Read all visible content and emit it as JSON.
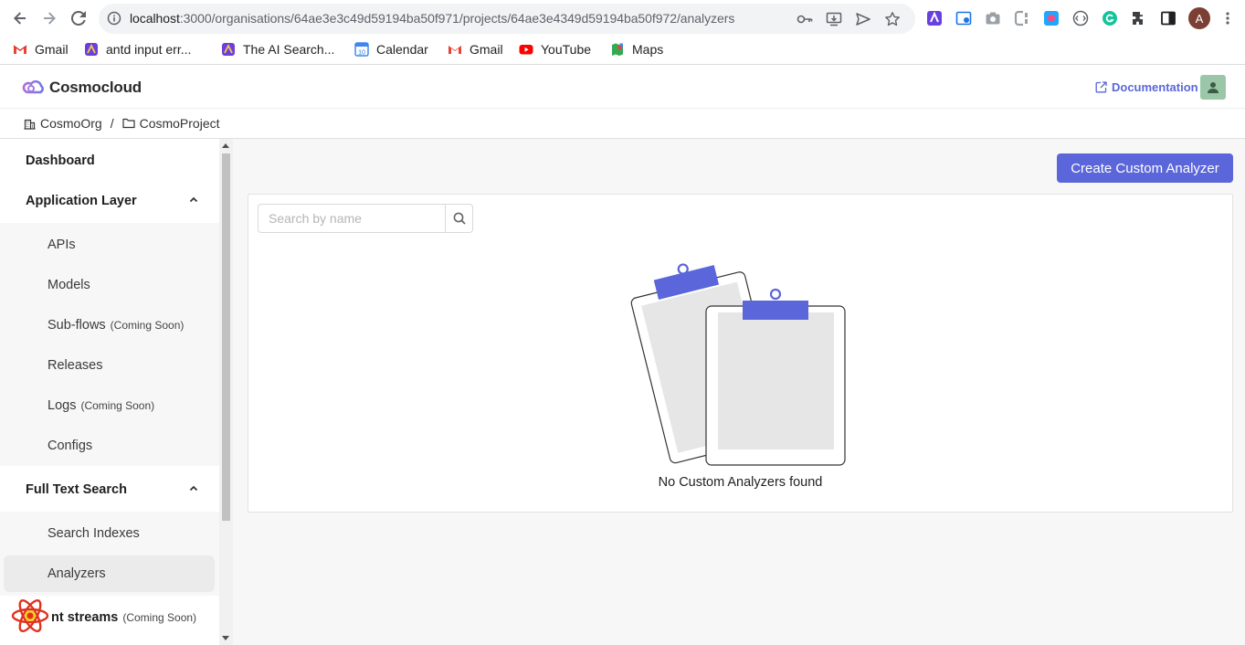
{
  "browser": {
    "url_host": "localhost",
    "url_path": ":3000/organisations/64ae3e3c49d59194ba50f971/projects/64ae3e4349d59194ba50f972/analyzers",
    "profile_initial": "A",
    "bookmarks": [
      {
        "label": "Gmail",
        "icon": "gmail-icon",
        "color": "#ea4335"
      },
      {
        "label": "antd input err...",
        "icon": "ai-search-icon",
        "color": "#7b3fe4"
      },
      {
        "label": "The AI Search...",
        "icon": "ai-search-icon",
        "color": "#7b3fe4"
      },
      {
        "label": "Calendar",
        "icon": "calendar-icon",
        "color": "#4285f4"
      },
      {
        "label": "Gmail",
        "icon": "gmail-icon",
        "color": "#ea4335"
      },
      {
        "label": "YouTube",
        "icon": "youtube-icon",
        "color": "#ff0000"
      },
      {
        "label": "Maps",
        "icon": "maps-icon",
        "color": "#34a853"
      }
    ]
  },
  "header": {
    "brand": "Cosmocloud",
    "doc_link": "Documentation"
  },
  "breadcrumb": {
    "org": "CosmoOrg",
    "separator": "/",
    "project": "CosmoProject"
  },
  "sidebar": {
    "dashboard": "Dashboard",
    "application_layer": "Application Layer",
    "app_items": [
      {
        "label": "APIs",
        "badge": ""
      },
      {
        "label": "Models",
        "badge": ""
      },
      {
        "label": "Sub-flows",
        "badge": "(Coming Soon)"
      },
      {
        "label": "Releases",
        "badge": ""
      },
      {
        "label": "Logs",
        "badge": "(Coming Soon)"
      },
      {
        "label": "Configs",
        "badge": ""
      }
    ],
    "full_text_search": "Full Text Search",
    "fts_items": [
      {
        "label": "Search Indexes"
      },
      {
        "label": "Analyzers"
      }
    ],
    "event_streams": "nt streams",
    "event_streams_badge": "(Coming Soon)"
  },
  "main": {
    "create_button": "Create Custom Analyzer",
    "search_placeholder": "Search by name",
    "empty_text": "No Custom Analyzers found"
  },
  "colors": {
    "accent": "#5a66d9",
    "main_bg": "#f7f7f7",
    "active_item_bg": "#ebebeb"
  }
}
